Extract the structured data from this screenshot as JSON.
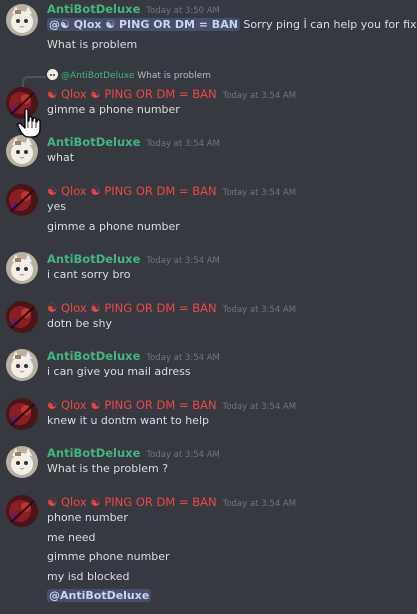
{
  "users": {
    "antibot": "AntiBotDeluxe",
    "qlox": "☯ Qlox ☯ PING OR DM = BAN"
  },
  "messages": [
    {
      "user": "AntiBotDeluxe",
      "time": "Today at 3:50 AM",
      "mention": "@☯ Qlox ☯ PING OR DM = BAN",
      "first_text": " Sorry ping İ can help you for fix",
      "lines": [
        "What is problem"
      ]
    },
    {
      "reply_to": "@AntiBotDeluxe",
      "reply_text": "What is problem",
      "user": "☯ Qlox ☯ PING OR DM = BAN",
      "time": "Today at 3:54 AM",
      "lines": [
        "gimme a phone number"
      ]
    },
    {
      "user": "AntiBotDeluxe",
      "time": "Today at 3:54 AM",
      "lines": [
        "what"
      ]
    },
    {
      "user": "☯ Qlox ☯ PING OR DM = BAN",
      "time": "Today at 3:54 AM",
      "lines": [
        "yes",
        "gimme a phone number"
      ]
    },
    {
      "user": "AntiBotDeluxe",
      "time": "Today at 3:54 AM",
      "lines": [
        "i cant sorry bro"
      ]
    },
    {
      "user": "☯ Qlox ☯ PING OR DM = BAN",
      "time": "Today at 3:54 AM",
      "lines": [
        "dotn be shy"
      ]
    },
    {
      "user": "AntiBotDeluxe",
      "time": "Today at 3:54 AM",
      "lines": [
        "i can give you mail adress"
      ]
    },
    {
      "user": "☯ Qlox ☯ PING OR DM = BAN",
      "time": "Today at 3:54 AM",
      "lines": [
        "knew it u dontm want to help"
      ]
    },
    {
      "user": "AntiBotDeluxe",
      "time": "Today at 3:54 AM",
      "lines": [
        "What is the problem ?"
      ]
    },
    {
      "user": "☯ Qlox ☯ PING OR DM = BAN",
      "time": "Today at 3:54 AM",
      "lines": [
        "phone number",
        "me need",
        "gimme phone number",
        "my isd blocked"
      ],
      "final_mention": "@AntiBotDeluxe"
    }
  ],
  "colors": {
    "background": "#36393f",
    "antibot_name": "#43b581",
    "qlox_name": "#f04747",
    "mention_bg": "#4e5b8a",
    "timestamp": "#72767d"
  },
  "icons": {
    "antibot_avatar": "white-cat-avatar-icon",
    "qlox_avatar": "red-dark-avatar-icon",
    "cursor": "hand-pointer-icon"
  }
}
